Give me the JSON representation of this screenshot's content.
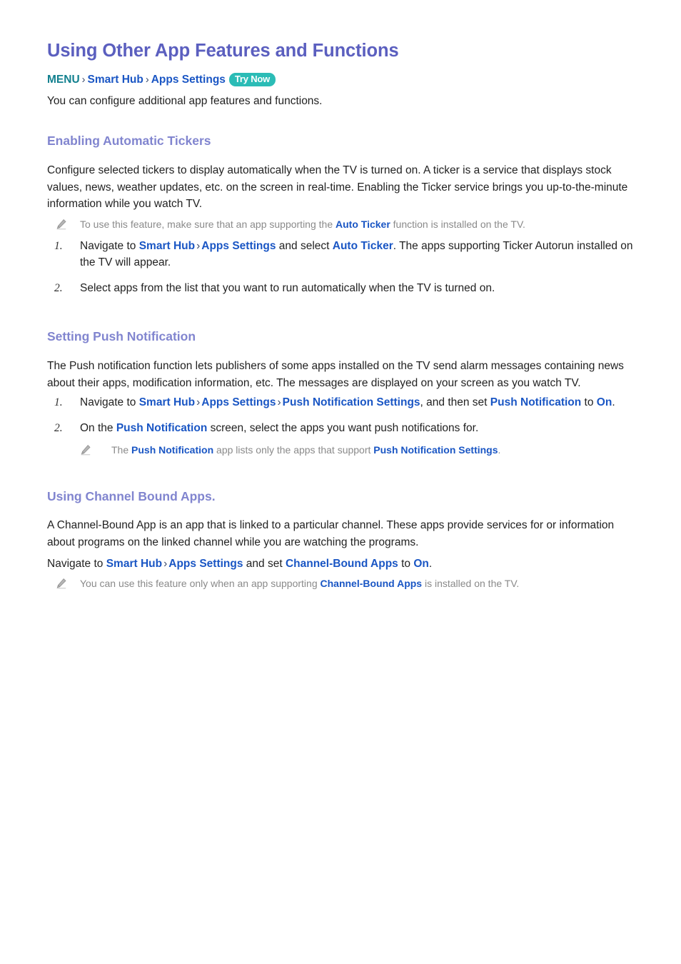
{
  "document": {
    "title": "Using Other App Features and Functions",
    "breadcrumb": {
      "menu_label": "MENU",
      "separator": "›",
      "items": [
        "Smart Hub",
        "Apps Settings"
      ],
      "badge": "Try Now"
    },
    "intro": "You can configure additional app features and functions."
  },
  "sections": [
    {
      "heading": "Enabling Automatic Tickers",
      "paragraph": "Configure selected tickers to display automatically when the TV is turned on. A ticker is a service that displays stock values, news, weather updates, etc. on the screen in real-time. Enabling the Ticker service brings you up-to-the-minute information while you watch TV.",
      "note": {
        "icon": "pencil-icon",
        "part1": "To use this feature, make sure that an app supporting the ",
        "kw1": "Auto Ticker",
        "part2": " function is installed on the TV."
      },
      "steps": [
        {
          "num": "1.",
          "part1": "Navigate to ",
          "kw1": "Smart Hub",
          "sep": "›",
          "kw2": "Apps Settings",
          "part2": " and select ",
          "kw3": "Auto Ticker",
          "part3": ". The apps supporting Ticker Autorun installed on the TV will appear."
        },
        {
          "num": "2.",
          "text": "Select apps from the list that you want to run automatically when the TV is turned on."
        }
      ]
    },
    {
      "heading": "Setting Push Notification",
      "paragraph": "The Push notification function lets publishers of some apps installed on the TV send alarm messages containing news about their apps, modification information, etc. The messages are displayed on your screen as you watch TV.",
      "steps": [
        {
          "num": "1.",
          "part1": "Navigate to ",
          "kw1": "Smart Hub",
          "sep": "›",
          "kw2": "Apps Settings",
          "sep2": "›",
          "kw3": "Push Notification Settings",
          "part2": ", and then set ",
          "kw4": "Push Notification",
          "part3": " to ",
          "kw5": "On",
          "part4": "."
        },
        {
          "num": "2.",
          "part1": "On the ",
          "kw1": "Push Notification",
          "part2": " screen, select the apps you want push notifications for."
        }
      ],
      "note": {
        "icon": "pencil-icon",
        "part1": "The ",
        "kw1": "Push Notification",
        "part2": " app lists only the apps that support ",
        "kw2": "Push Notification Settings",
        "part3": "."
      }
    },
    {
      "heading": "Using Channel Bound Apps.",
      "paragraph": "A Channel-Bound App is an app that is linked to a particular channel. These apps provide services for or information about programs on the linked channel while you are watching the programs.",
      "nav_line": {
        "part1": "Navigate to ",
        "kw1": "Smart Hub",
        "sep": "›",
        "kw2": "Apps Settings",
        "part2": " and set ",
        "kw3": "Channel-Bound Apps",
        "part3": " to ",
        "kw4": "On",
        "part4": "."
      },
      "note": {
        "icon": "pencil-icon",
        "part1": "You can use this feature only when an app supporting ",
        "kw1": "Channel-Bound Apps",
        "part2": " is installed on the TV."
      }
    }
  ],
  "colors": {
    "title_purple": "#5b5fbf",
    "heading_lavender": "#8185cf",
    "link_blue": "#1a56c4",
    "menu_teal": "#12808f",
    "badge_teal": "#2bbcb6",
    "body_text": "#222222",
    "note_gray": "#8a8a8a"
  }
}
